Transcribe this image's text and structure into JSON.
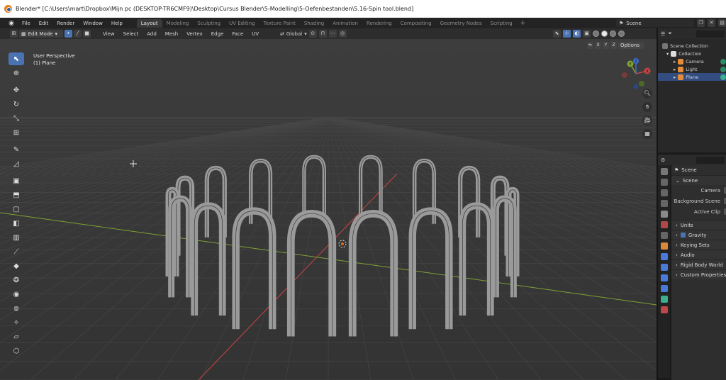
{
  "window": {
    "title": "Blender* [C:\\Users\\mart\\Dropbox\\Mijn pc (DESKTOP-TR6CMF9)\\Desktop\\Cursus Blender\\5-Modelling\\5-Oefenbestanden\\5.16-Spin tool.blend]"
  },
  "menu": [
    "File",
    "Edit",
    "Render",
    "Window",
    "Help"
  ],
  "workspaces": [
    "Layout",
    "Modeling",
    "Sculpting",
    "UV Editing",
    "Texture Paint",
    "Shading",
    "Animation",
    "Rendering",
    "Compositing",
    "Geometry Nodes",
    "Scripting"
  ],
  "active_workspace": "Layout",
  "scene_name": "Scene",
  "viewport_header": {
    "mode": "Edit Mode",
    "menus": [
      "View",
      "Select",
      "Add",
      "Mesh",
      "Vertex",
      "Edge",
      "Face",
      "UV"
    ],
    "transform_orientation": "Global"
  },
  "viewport": {
    "view_name": "User Perspective",
    "object_label": "(1) Plane",
    "options_label": "Options",
    "axes": [
      "X",
      "Y",
      "Z"
    ],
    "gizmo_labels": {
      "x": "X",
      "y": "Y",
      "z": "Z"
    }
  },
  "outliner": {
    "root": "Scene Collection",
    "collection": "Collection",
    "objects": [
      "Camera",
      "Light",
      "Plane"
    ],
    "selected": "Plane"
  },
  "properties": {
    "title": "Scene",
    "section": "Scene",
    "fields": [
      "Camera",
      "Background Scene",
      "Active Clip"
    ],
    "panels": [
      "Units",
      "Gravity",
      "Keying Sets",
      "Audio",
      "Rigid Body World",
      "Custom Properties"
    ],
    "gravity_checked": true
  },
  "colors": {
    "accent": "#4a73b3",
    "x_axis": "#c84444",
    "y_axis": "#7ea234",
    "z_axis": "#3c6fd1",
    "selected_row": "#334d80"
  }
}
